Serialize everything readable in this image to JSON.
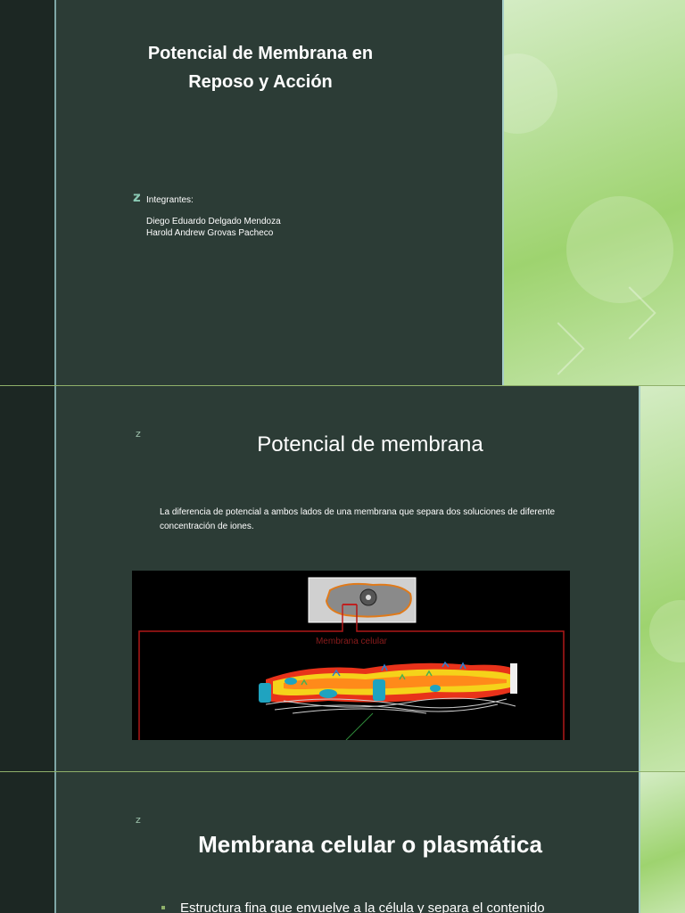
{
  "slides": [
    {
      "title_lines": [
        "Potencial de Membrana en",
        "Reposo y Acción"
      ],
      "z_mark": "z",
      "members_label": "Integrantes:",
      "members": [
        "Diego Eduardo Delgado Mendoza",
        "Harold Andrew Grovas Pacheco"
      ]
    },
    {
      "z_mark": "z",
      "title": "Potencial de membrana",
      "body": "La diferencia de potencial a ambos lados de una membrana que separa dos soluciones de diferente concentración de iones.",
      "figure": {
        "label": "Membrana celular",
        "colors": {
          "background": "#000000",
          "frame": "#b01818",
          "membrane_outer": "#e8321a",
          "membrane_core": "#f5d21a",
          "protein": "#1fa3c0"
        }
      }
    },
    {
      "z_mark": "z",
      "title": "Membrana celular o plasmática",
      "bullets": [
        "Estructura fina que envuelve a la célula y separa el contenido"
      ]
    }
  ],
  "colors": {
    "slide_bg": "#2c3c36",
    "left_bar": "#1c2723",
    "accent_line": "#7fa7a6",
    "green_panel": "#b9e09b"
  }
}
